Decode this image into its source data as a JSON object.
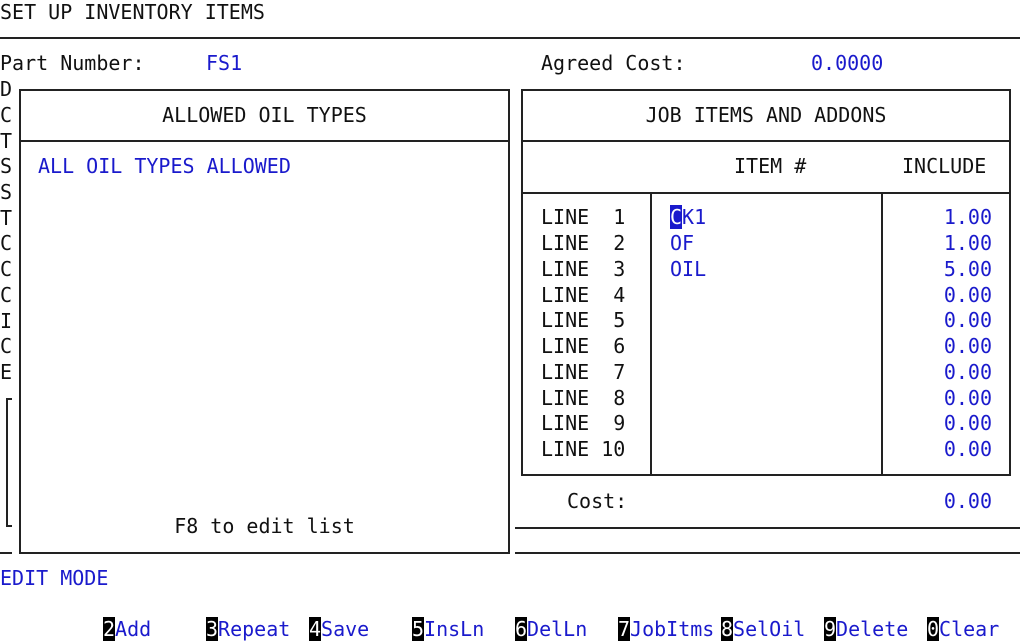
{
  "screen_title": "SET UP INVENTORY ITEMS",
  "part_number": {
    "label": "Part Number:",
    "value": "FS1"
  },
  "agreed_cost": {
    "label": "Agreed Cost:",
    "value": "0.0000"
  },
  "left_column_letters": [
    "D",
    "C",
    "T",
    "S",
    "S",
    "T",
    "C",
    "C",
    "C",
    "I",
    "C",
    "E"
  ],
  "oil_panel": {
    "title": "ALLOWED OIL TYPES",
    "entry": "ALL OIL TYPES ALLOWED",
    "hint": "F8 to edit list"
  },
  "job_panel": {
    "title": "JOB ITEMS AND ADDONS",
    "col_item": "ITEM #",
    "col_include": "INCLUDE",
    "rows": [
      {
        "line": "LINE  1",
        "item_first": "C",
        "item_rest": "K1",
        "include": "1.00"
      },
      {
        "line": "LINE  2",
        "item_first": "",
        "item_rest": "OF",
        "include": "1.00"
      },
      {
        "line": "LINE  3",
        "item_first": "",
        "item_rest": "OIL",
        "include": "5.00"
      },
      {
        "line": "LINE  4",
        "item_first": "",
        "item_rest": "",
        "include": "0.00"
      },
      {
        "line": "LINE  5",
        "item_first": "",
        "item_rest": "",
        "include": "0.00"
      },
      {
        "line": "LINE  6",
        "item_first": "",
        "item_rest": "",
        "include": "0.00"
      },
      {
        "line": "LINE  7",
        "item_first": "",
        "item_rest": "",
        "include": "0.00"
      },
      {
        "line": "LINE  8",
        "item_first": "",
        "item_rest": "",
        "include": "0.00"
      },
      {
        "line": "LINE  9",
        "item_first": "",
        "item_rest": "",
        "include": "0.00"
      },
      {
        "line": "LINE 10",
        "item_first": "",
        "item_rest": "",
        "include": "0.00"
      }
    ],
    "cost_label": "Cost:",
    "cost_value": "0.00"
  },
  "mode": "EDIT MODE",
  "function_keys": [
    {
      "num": "2",
      "label": "Add"
    },
    {
      "num": "3",
      "label": "Repeat"
    },
    {
      "num": "4",
      "label": "Save"
    },
    {
      "num": "5",
      "label": "InsLn"
    },
    {
      "num": "6",
      "label": "DelLn"
    },
    {
      "num": "7",
      "label": "JobItms"
    },
    {
      "num": "8",
      "label": "SelOil"
    },
    {
      "num": "9",
      "label": "Delete"
    },
    {
      "num": "0",
      "label": "Clear"
    }
  ]
}
